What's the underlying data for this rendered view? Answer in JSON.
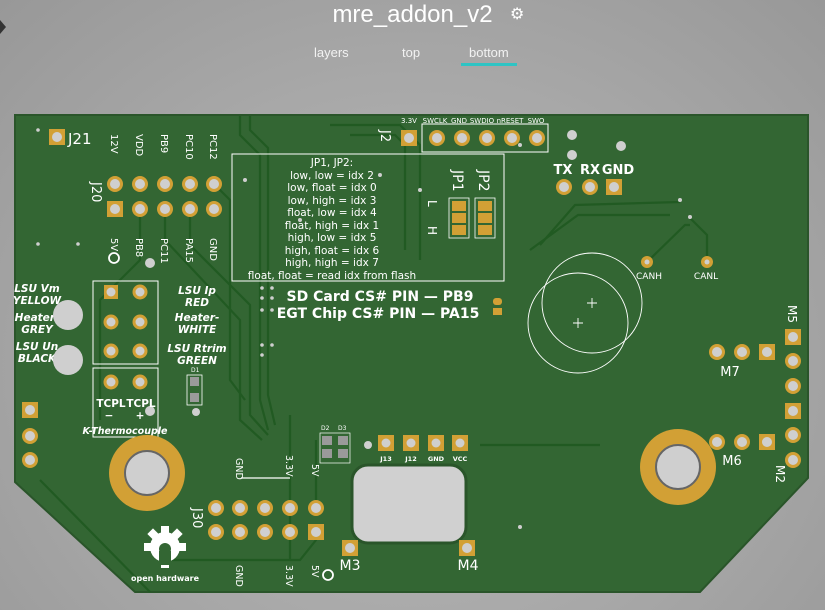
{
  "header": {
    "title": "mre_addon_v2",
    "settings_icon": "gear-icon",
    "tabs": [
      {
        "label": "layers",
        "active": false
      },
      {
        "label": "top",
        "active": false
      },
      {
        "label": "bottom",
        "active": true
      }
    ],
    "accent_color": "#2ec4c4"
  },
  "board": {
    "colors": {
      "soldermask": "#336633",
      "copper": "#d2a035",
      "silkscreen": "#ffffff"
    },
    "j21": "J21",
    "j20": {
      "ref": "J20",
      "top_labels": [
        "12V",
        "VDD",
        "PB9",
        "PC10",
        "PC12"
      ],
      "bottom_labels": [
        "5V",
        "PB8",
        "PC11",
        "PA15",
        "GND"
      ]
    },
    "lsu_left": [
      "LSU Vm",
      "YELLOW",
      "Heater-",
      "GREY",
      "LSU Un",
      "BLACK"
    ],
    "lsu_right": [
      "LSU Ip",
      "RED",
      "Heater-",
      "WHITE",
      "LSU Rtrim",
      "GREEN"
    ],
    "d1": "D1",
    "tcpl": {
      "minus_label": "TCPL",
      "plus_label": "TCPL",
      "minus": "−",
      "plus": "+",
      "caption": "K-Thermocouple"
    },
    "j2": {
      "ref": "J2",
      "labels": [
        "3.3V",
        "SWCLK",
        "GND",
        "SWDIO",
        "nRESET",
        "SWO"
      ]
    },
    "jumper_note": [
      "JP1, JP2:",
      "low, low = idx 2",
      "low, float = idx 0",
      "low, high = idx 3",
      "float, low = idx 4",
      "float, high = idx 1",
      "high, low = idx 5",
      "high, float = idx 6",
      "high, high = idx 7",
      "float, float = read idx from flash"
    ],
    "jp1": "JP1",
    "jp2": "JP2",
    "jp_low": "L",
    "jp_high": "H",
    "cs_notes": [
      "SD Card CS# PIN — PB9",
      "EGT Chip CS# PIN — PA15"
    ],
    "uart": [
      "TX",
      "RX",
      "GND"
    ],
    "can": [
      "CANH",
      "CANL"
    ],
    "m5": "M5",
    "m7": "M7",
    "m6": "M6",
    "m2": "M2",
    "m3": "M3",
    "m4": "M4",
    "d2": "D2",
    "d3": "D3",
    "small_header": [
      "J13",
      "J12",
      "GND",
      "VCC"
    ],
    "j30": {
      "ref": "J30",
      "top_labels": [
        "GND",
        "3.3V",
        "5V"
      ],
      "bottom_labels": [
        "GND",
        "3.3V",
        "5V"
      ]
    },
    "oshw": "open hardware"
  }
}
